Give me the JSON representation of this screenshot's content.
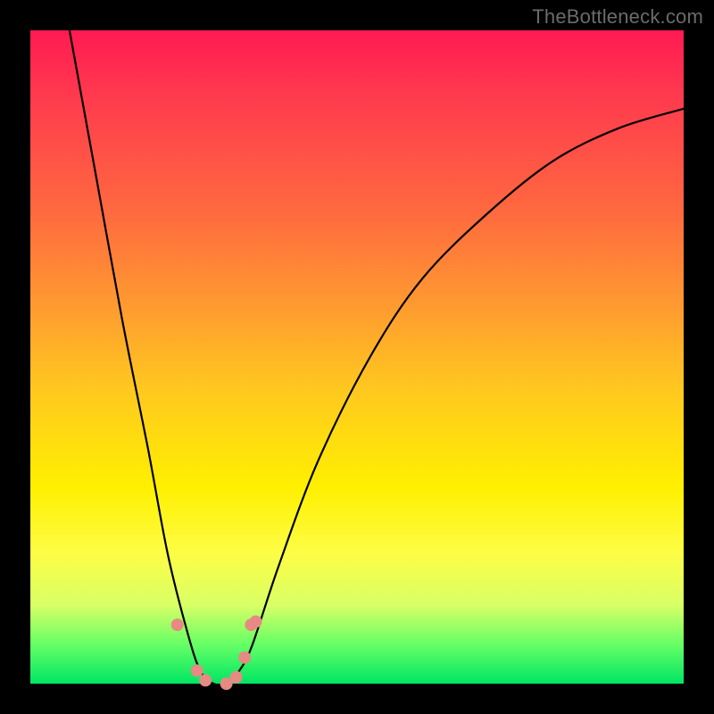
{
  "watermark": "TheBottleneck.com",
  "chart_data": {
    "type": "line",
    "title": "",
    "xlabel": "",
    "ylabel": "",
    "xlim": [
      0,
      1
    ],
    "ylim": [
      0,
      1
    ],
    "curve": {
      "name": "bottleneck-curve",
      "note": "V-shaped bottleneck curve; y is bottleneck level (1 top/red = worst, 0 bottom/green = best). x is normalized position of minimum around 0.29.",
      "x": [
        0.06,
        0.1,
        0.14,
        0.18,
        0.21,
        0.24,
        0.26,
        0.28,
        0.3,
        0.32,
        0.34,
        0.38,
        0.44,
        0.52,
        0.6,
        0.7,
        0.8,
        0.9,
        1.0
      ],
      "y": [
        1.0,
        0.78,
        0.56,
        0.36,
        0.2,
        0.08,
        0.02,
        0.0,
        0.0,
        0.02,
        0.06,
        0.18,
        0.34,
        0.5,
        0.62,
        0.72,
        0.8,
        0.85,
        0.88
      ]
    },
    "markers": {
      "name": "highlight-dots",
      "color": "#e68a83",
      "points": [
        {
          "x": 0.225,
          "y": 0.09
        },
        {
          "x": 0.255,
          "y": 0.02
        },
        {
          "x": 0.268,
          "y": 0.005
        },
        {
          "x": 0.3,
          "y": 0.0
        },
        {
          "x": 0.315,
          "y": 0.01
        },
        {
          "x": 0.328,
          "y": 0.04
        },
        {
          "x": 0.338,
          "y": 0.09
        },
        {
          "x": 0.345,
          "y": 0.095
        }
      ]
    }
  }
}
